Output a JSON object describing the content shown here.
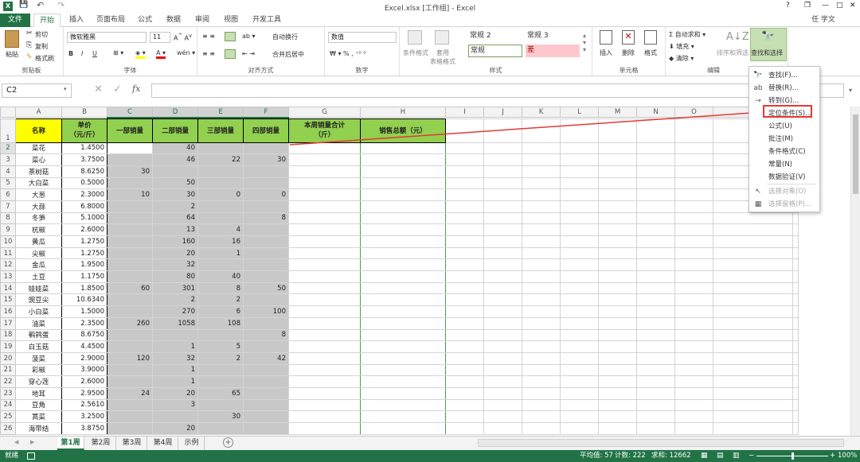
{
  "title": "Excel.xlsx  [工作组] - Excel",
  "qat": {
    "save": "💾",
    "undo": "↶",
    "redo": "↷"
  },
  "user": "任 学文",
  "window": {
    "help": "?",
    "restore": "❐",
    "minimize": "—",
    "maximize": "□",
    "close": "✕"
  },
  "tabs": [
    "文件",
    "开始",
    "插入",
    "页面布局",
    "公式",
    "数据",
    "审阅",
    "视图",
    "开发工具"
  ],
  "ribbon": {
    "clipboard": {
      "label": "剪贴板",
      "paste": "粘贴",
      "cut": "剪切",
      "copy": "复制",
      "painter": "格式刷"
    },
    "font": {
      "label": "字体",
      "name": "微软雅黑",
      "size": "11",
      "bold": "B",
      "italic": "I",
      "underline": "U"
    },
    "align": {
      "label": "对齐方式",
      "wrap": "自动换行",
      "merge": "合并后居中"
    },
    "number": {
      "label": "数字",
      "format": "数值"
    },
    "styles": {
      "label": "样式",
      "cond": "条件格式",
      "table": "套用\n表格格式",
      "s1": "常规 2",
      "s2": "常规 3",
      "s3": "常规",
      "s4": "差"
    },
    "cells": {
      "label": "单元格",
      "insert": "插入",
      "delete": "删除",
      "format": "格式"
    },
    "edit": {
      "label": "编辑",
      "autosum": "自动求和",
      "fill": "填充",
      "clear": "清除",
      "sort": "排序和筛选",
      "find": "查找和选择"
    }
  },
  "namebox": "C2",
  "fx": "fx",
  "columns": [
    "A",
    "B",
    "C",
    "D",
    "E",
    "F",
    "G",
    "H",
    "I",
    "J",
    "K",
    "L",
    "M",
    "N",
    "O",
    "P"
  ],
  "headers": [
    "名称",
    "单价\n（元/斤）",
    "一部销量",
    "二部销量",
    "三部销量",
    "四部销量",
    "本周销量合计\n（斤）",
    "销售总额（元）"
  ],
  "rows": [
    [
      "2",
      "菜花",
      "1.4500",
      "",
      "40",
      "",
      ""
    ],
    [
      "3",
      "菜心",
      "3.7500",
      "",
      "46",
      "22",
      "30"
    ],
    [
      "4",
      "茶树菇",
      "8.6250",
      "30",
      "",
      "",
      ""
    ],
    [
      "5",
      "大白菜",
      "0.5000",
      "",
      "50",
      "",
      ""
    ],
    [
      "6",
      "大葱",
      "2.3000",
      "10",
      "30",
      "0",
      "0"
    ],
    [
      "7",
      "大蒜",
      "6.8000",
      "",
      "2",
      "",
      ""
    ],
    [
      "8",
      "冬笋",
      "5.1000",
      "",
      "64",
      "",
      "8"
    ],
    [
      "9",
      "杭椒",
      "2.6000",
      "",
      "13",
      "4",
      ""
    ],
    [
      "10",
      "黄瓜",
      "1.2750",
      "",
      "160",
      "16",
      ""
    ],
    [
      "11",
      "尖椒",
      "1.2750",
      "",
      "20",
      "1",
      ""
    ],
    [
      "12",
      "金瓜",
      "1.9500",
      "",
      "32",
      "",
      ""
    ],
    [
      "13",
      "土豆",
      "1.1750",
      "",
      "80",
      "40",
      ""
    ],
    [
      "14",
      "娃娃菜",
      "1.8500",
      "60",
      "301",
      "8",
      "50"
    ],
    [
      "15",
      "豌豆尖",
      "10.6340",
      "",
      "2",
      "2",
      ""
    ],
    [
      "16",
      "小白菜",
      "1.5000",
      "",
      "270",
      "6",
      "100"
    ],
    [
      "17",
      "油菜",
      "2.3500",
      "260",
      "1058",
      "108",
      ""
    ],
    [
      "18",
      "鹌鹑蛋",
      "8.6750",
      "",
      "",
      "",
      "8"
    ],
    [
      "19",
      "白玉菇",
      "4.4500",
      "",
      "1",
      "5",
      ""
    ],
    [
      "20",
      "菠菜",
      "2.9000",
      "120",
      "32",
      "2",
      "42"
    ],
    [
      "21",
      "彩椒",
      "3.9000",
      "",
      "1",
      "",
      ""
    ],
    [
      "22",
      "穿心莲",
      "2.6000",
      "",
      "1",
      "",
      ""
    ],
    [
      "23",
      "地耳",
      "2.9500",
      "24",
      "20",
      "65",
      ""
    ],
    [
      "24",
      "豆角",
      "2.5610",
      "",
      "3",
      "",
      ""
    ],
    [
      "25",
      "蒿菜",
      "3.2500",
      "",
      "",
      "30",
      ""
    ],
    [
      "26",
      "海带结",
      "3.8750",
      "",
      "20",
      "",
      ""
    ]
  ],
  "menu": [
    {
      "icon": "🔭",
      "label": "查找(F)...",
      "disabled": false
    },
    {
      "icon": "ab",
      "label": "替换(R)...",
      "disabled": false
    },
    {
      "icon": "→",
      "label": "转到(G)...",
      "disabled": false
    },
    {
      "icon": "",
      "label": "定位条件(S)...",
      "disabled": false
    },
    {
      "icon": "",
      "label": "公式(U)",
      "disabled": false
    },
    {
      "icon": "",
      "label": "批注(M)",
      "disabled": false
    },
    {
      "icon": "",
      "label": "条件格式(C)",
      "disabled": false
    },
    {
      "icon": "",
      "label": "常量(N)",
      "disabled": false
    },
    {
      "icon": "",
      "label": "数据验证(V)",
      "disabled": false
    },
    {
      "icon": "↖",
      "label": "选择对象(O)",
      "disabled": true
    },
    {
      "icon": "▦",
      "label": "选择窗格(P)...",
      "disabled": true
    }
  ],
  "sheets": [
    "第1周",
    "第2周",
    "第3周",
    "第4周",
    "示例"
  ],
  "status": {
    "ready": "就绪",
    "avg": "平均值: 57",
    "count": "计数: 222",
    "sum": "求和: 12662",
    "zoom": "100%"
  },
  "colors": {
    "green": "#217346",
    "header_fill": "#92d050",
    "name_fill": "#ffff00",
    "gray": "#c8c8c8",
    "red": "#e53935"
  }
}
